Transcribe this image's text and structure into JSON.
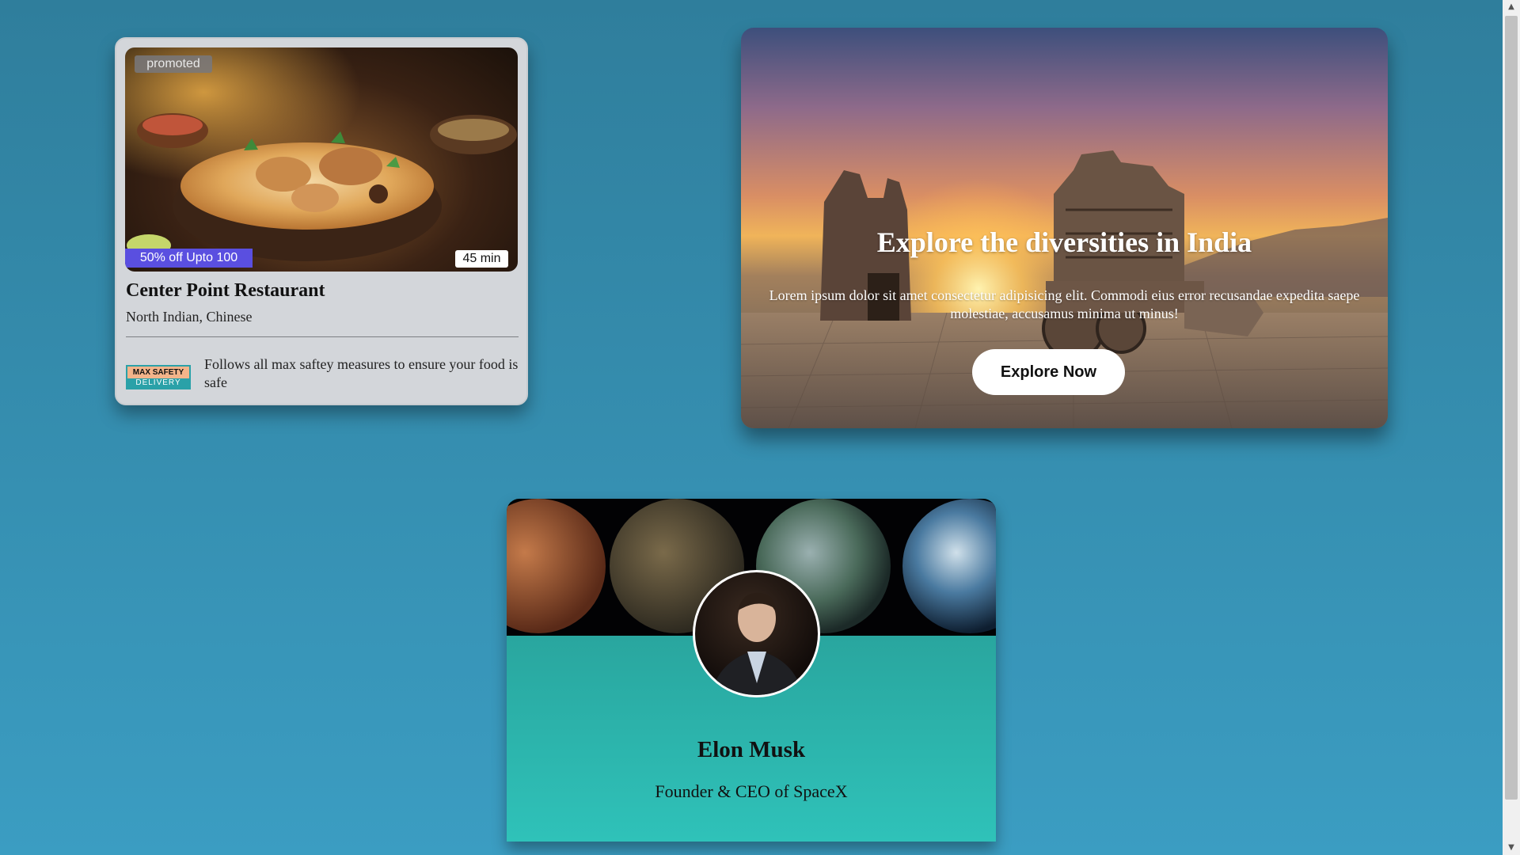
{
  "restaurant_card": {
    "promoted_label": "promoted",
    "offer": "50% off Upto 100",
    "delivery_time": "45 min",
    "name": "Center Point Restaurant",
    "cuisine": "North Indian, Chinese",
    "badge_top": "MAX SAFETY",
    "badge_bottom": "DELIVERY",
    "safety_note": "Follows all max saftey measures to ensure your food is safe"
  },
  "india_card": {
    "title": "Explore the diversities in India",
    "description": "Lorem ipsum dolor sit amet consectetur adipisicing elit. Commodi eius error recusandae expedita saepe molestiae, accusamus minima ut minus!",
    "button_label": "Explore Now"
  },
  "profile_card": {
    "name": "Elon Musk",
    "role": "Founder & CEO of SpaceX"
  },
  "colors": {
    "page_gradient_top": "#2f7e9c",
    "page_gradient_bottom": "#3b9dc2",
    "offer_badge": "#5a4fe0",
    "profile_gradient_top": "#25938d",
    "profile_gradient_bottom": "#2fc2b9"
  },
  "icons": {
    "scroll_up": "▲",
    "scroll_down": "▼"
  }
}
